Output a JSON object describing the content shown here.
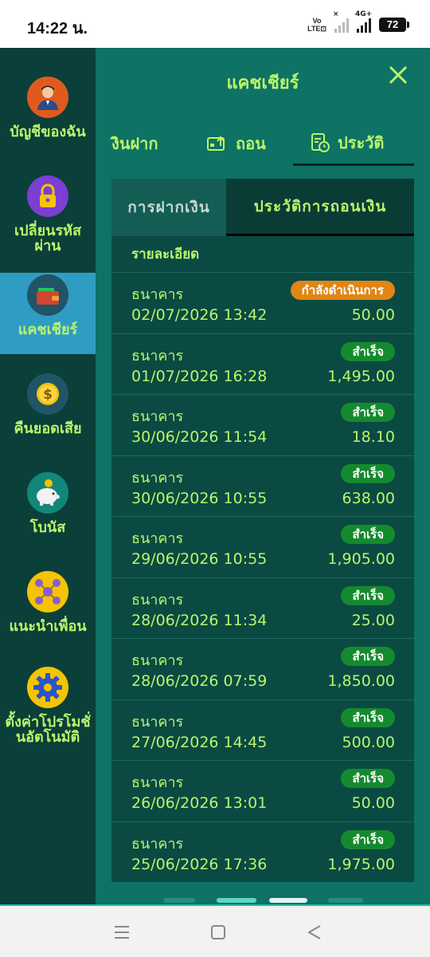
{
  "status_bar": {
    "time": "14:22 น.",
    "volte": [
      "Vo",
      "LTE⊡"
    ],
    "network": "4G+",
    "battery": "72"
  },
  "sidebar": {
    "items": [
      {
        "label": "บัญชีของฉัน",
        "icon": "user-icon",
        "active": false
      },
      {
        "label": "เปลี่ยนรหัสผ่าน",
        "icon": "lock-icon",
        "active": false
      },
      {
        "label": "แคชเชียร์",
        "icon": "wallet-icon",
        "active": true
      },
      {
        "label": "คืนยอดเสีย",
        "icon": "coin-icon",
        "active": false
      },
      {
        "label": "โบนัส",
        "icon": "piggy-bank-icon",
        "active": false
      },
      {
        "label": "แนะนำเพื่อน",
        "icon": "referral-network-icon",
        "active": false
      },
      {
        "label": "ตั้งค่าโปรโมชั่นอัตโนมัติ",
        "icon": "gear-icon",
        "active": false
      }
    ]
  },
  "panel": {
    "title": "แคชเชียร์",
    "tabs": [
      {
        "label": "งินฝาก",
        "icon": "deposit-icon",
        "active": false
      },
      {
        "label": "ถอน",
        "icon": "withdraw-icon",
        "active": false
      },
      {
        "label": "ประวัติ",
        "icon": "history-icon",
        "active": true
      }
    ],
    "sub_tabs": [
      {
        "label": "การฝากเงิน",
        "active": false
      },
      {
        "label": "ประวัติการถอนเงิน",
        "active": true
      }
    ],
    "history_header": "รายละเอียด",
    "rows": [
      {
        "bank": "ธนาคาร",
        "datetime": "02/07/2026 13:42",
        "amount": "50.00",
        "status": "กำลังดำเนินการ",
        "status_type": "pending"
      },
      {
        "bank": "ธนาคาร",
        "datetime": "01/07/2026 16:28",
        "amount": "1,495.00",
        "status": "สำเร็จ",
        "status_type": "ok"
      },
      {
        "bank": "ธนาคาร",
        "datetime": "30/06/2026 11:54",
        "amount": "18.10",
        "status": "สำเร็จ",
        "status_type": "ok"
      },
      {
        "bank": "ธนาคาร",
        "datetime": "30/06/2026 10:55",
        "amount": "638.00",
        "status": "สำเร็จ",
        "status_type": "ok"
      },
      {
        "bank": "ธนาคาร",
        "datetime": "29/06/2026 10:55",
        "amount": "1,905.00",
        "status": "สำเร็จ",
        "status_type": "ok"
      },
      {
        "bank": "ธนาคาร",
        "datetime": "28/06/2026 11:34",
        "amount": "25.00",
        "status": "สำเร็จ",
        "status_type": "ok"
      },
      {
        "bank": "ธนาคาร",
        "datetime": "28/06/2026 07:59",
        "amount": "1,850.00",
        "status": "สำเร็จ",
        "status_type": "ok"
      },
      {
        "bank": "ธนาคาร",
        "datetime": "27/06/2026 14:45",
        "amount": "500.00",
        "status": "สำเร็จ",
        "status_type": "ok"
      },
      {
        "bank": "ธนาคาร",
        "datetime": "26/06/2026 13:01",
        "amount": "50.00",
        "status": "สำเร็จ",
        "status_type": "ok"
      },
      {
        "bank": "ธนาคาร",
        "datetime": "25/06/2026 17:36",
        "amount": "1,975.00",
        "status": "สำเร็จ",
        "status_type": "ok"
      }
    ]
  },
  "colors": {
    "accent_text": "#b9f56a",
    "panel_bg": "#0e7264",
    "sidebar_bg": "#0b3f39",
    "active_sidebar": "#2f9cc3",
    "success_badge": "#148a2e",
    "pending_badge": "#e18614"
  },
  "navbar": {
    "buttons": [
      "menu-icon",
      "home-square-icon",
      "back-triangle-icon"
    ]
  }
}
